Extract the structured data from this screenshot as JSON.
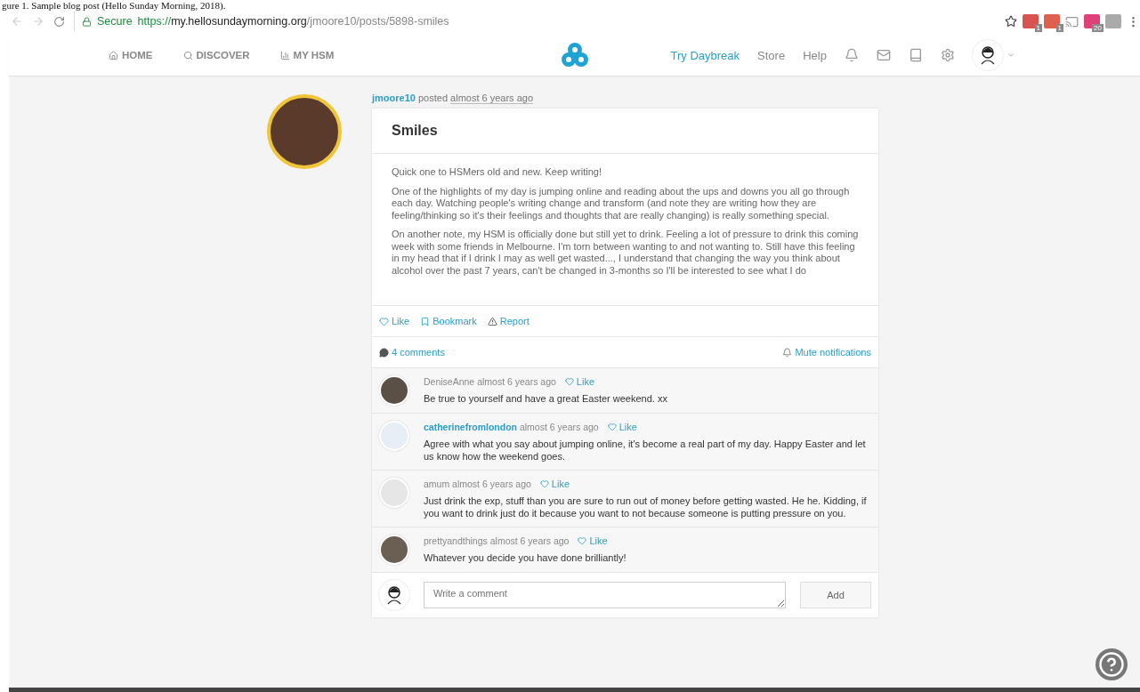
{
  "caption": "gure 1. Sample blog post (Hello Sunday Morning, 2018).",
  "browser": {
    "secure_label": "Secure",
    "url_scheme": "https://",
    "url_host": "my.hellosundaymorning.org",
    "url_path": "/jmoore10/posts/5898-smiles",
    "extension_badges": [
      "1",
      "1",
      "20"
    ]
  },
  "nav": {
    "left": [
      {
        "label": "HOME"
      },
      {
        "label": "DISCOVER"
      },
      {
        "label": "MY HSM"
      }
    ],
    "right": [
      {
        "label": "Try Daybreak",
        "accent": true
      },
      {
        "label": "Store",
        "accent": false
      },
      {
        "label": "Help",
        "accent": false
      }
    ]
  },
  "post": {
    "author": "jmoore10",
    "verb": "posted",
    "time": "almost 6 years ago",
    "title": "Smiles",
    "paragraphs": [
      "Quick one to HSMers old and new. Keep writing!",
      "One of the highlights of my day is jumping online and reading about the ups and downs you all go through each day. Watching people's writing change and transform (and note they are writing how they are feeling/thinking so it's their feelings and thoughts that are really changing) is really something special.",
      "On another note, my HSM is officially done but still yet to drink. Feeling a lot of pressure to drink this coming week with some friends in Melbourne. I'm torn between wanting to and not wanting to. Still have this feeling in my head that if I drink I may as well get wasted..., I understand that changing the way you think about alcohol over the past 7 years, can't be changed in 3-months so I'll be interested to see what I do"
    ],
    "actions": [
      "Like",
      "Bookmark",
      "Report"
    ],
    "comments_count": "4 comments",
    "mute": "Mute notifications"
  },
  "comments": [
    {
      "author": "DeniseAnne",
      "highlighted": false,
      "time": "almost 6 years ago",
      "like": "Like",
      "text": "Be true to yourself and have a great Easter weekend. xx"
    },
    {
      "author": "catherinefromlondon",
      "highlighted": true,
      "time": "almost 6 years ago",
      "like": "Like",
      "text": "Agree with what you say about jumping online, it's become a real part of my day. Happy Easter and let us know how the weekend goes."
    },
    {
      "author": "amum",
      "highlighted": false,
      "time": "almost 6 years ago",
      "like": "Like",
      "text": "Just drink the exp, stuff than you are sure to run out of money before getting wasted. He he. Kidding, if you want to drink just do it because you want to not because someone is putting pressure on you."
    },
    {
      "author": "prettyandthings",
      "highlighted": false,
      "time": "almost 6 years ago",
      "like": "Like",
      "text": "Whatever you decide you have done brilliantly!"
    }
  ],
  "composer": {
    "placeholder": "Write a comment",
    "button": "Add"
  }
}
